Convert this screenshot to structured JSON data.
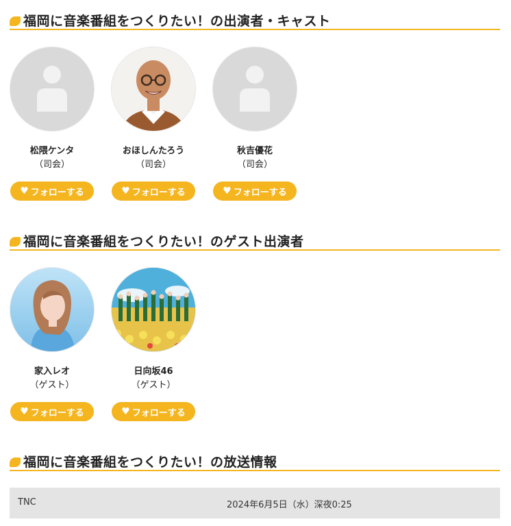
{
  "sections": {
    "cast_title": "福岡に音楽番組をつくりたい！の出演者・キャスト",
    "guest_title": "福岡に音楽番組をつくりたい！のゲスト出演者",
    "broadcast_title": "福岡に音楽番組をつくりたい！の放送情報"
  },
  "follow_label": "フォローする",
  "cast": [
    {
      "name": "松隈ケンタ",
      "role": "（司会）",
      "avatar": "placeholder"
    },
    {
      "name": "おほしんたろう",
      "role": "（司会）",
      "avatar": "photo"
    },
    {
      "name": "秋吉優花",
      "role": "（司会）",
      "avatar": "placeholder"
    }
  ],
  "guests": [
    {
      "name": "家入レオ",
      "role": "（ゲスト）",
      "avatar": "photo"
    },
    {
      "name": "日向坂46",
      "role": "（ゲスト）",
      "avatar": "photo"
    }
  ],
  "broadcast": {
    "station": "TNC",
    "datetime": "2024年6月5日（水）深夜0:25"
  },
  "colors": {
    "accent": "#f4b51f",
    "placeholder_bg": "#d9d9d9",
    "broadcast_bg": "#e4e4e4"
  }
}
